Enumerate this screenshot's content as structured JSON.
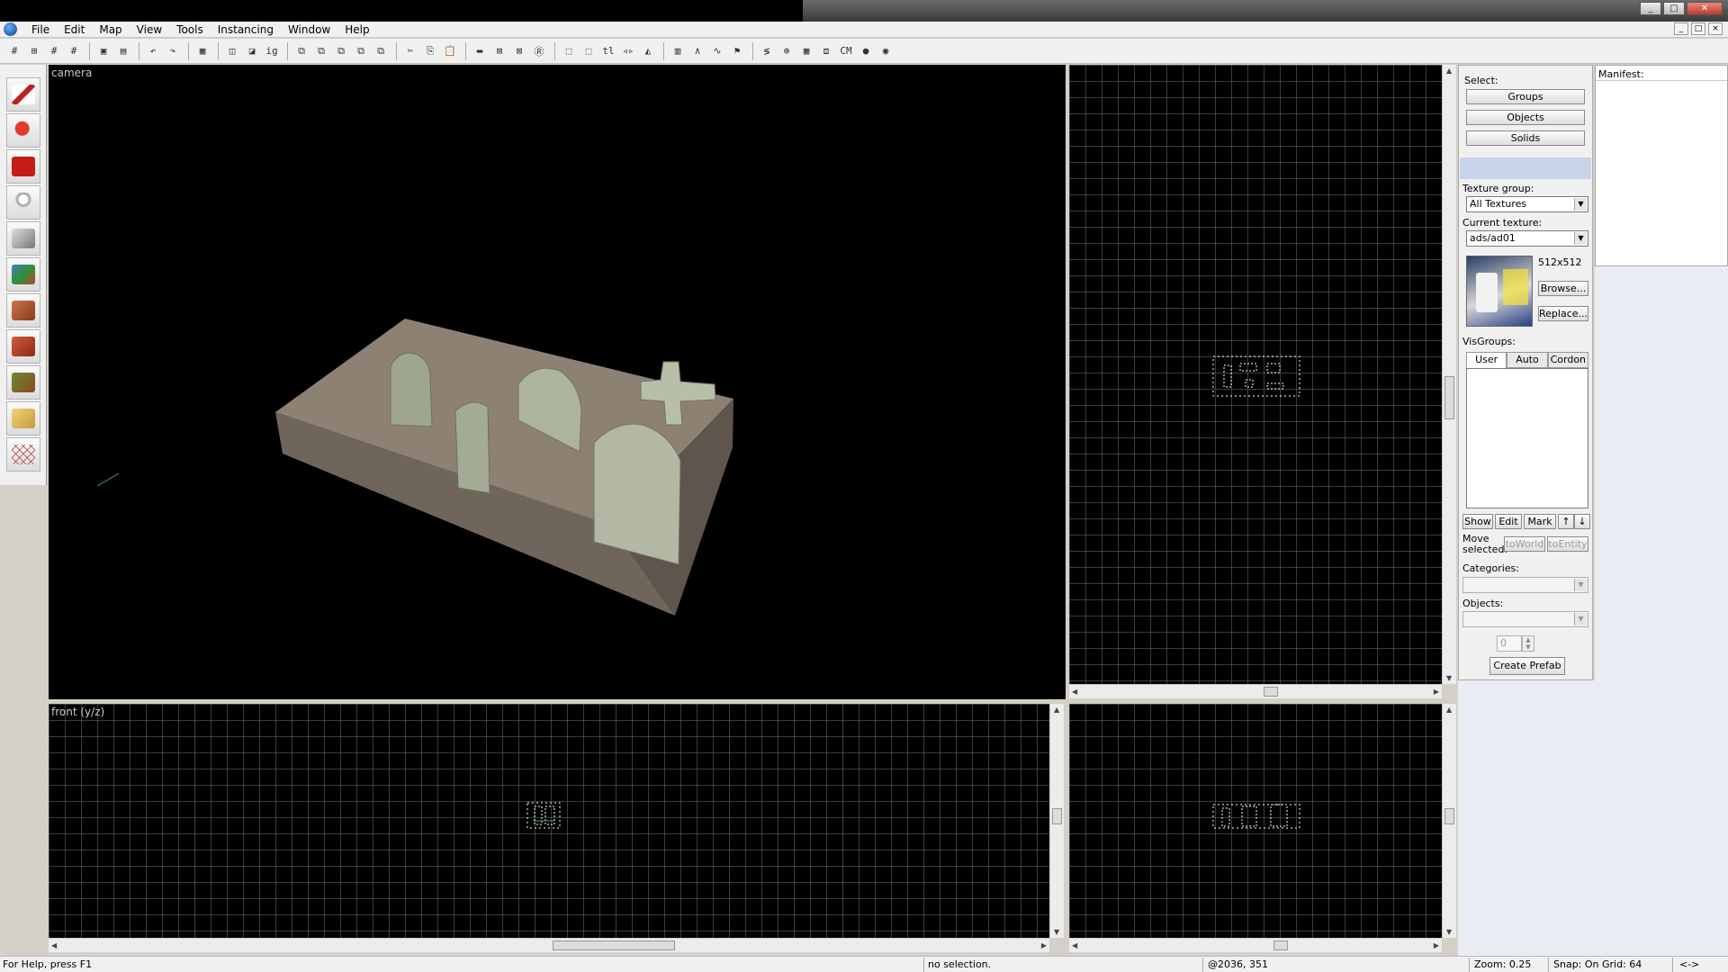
{
  "window": {
    "minimize": "_",
    "maximize": "□",
    "close": "✕"
  },
  "menu": [
    "File",
    "Edit",
    "Map",
    "View",
    "Tools",
    "Instancing",
    "Window",
    "Help"
  ],
  "mdi": [
    "_",
    "□",
    "×"
  ],
  "toolbar_icons": [
    "grid-toggle-icon",
    "grid-3d-icon",
    "grid-small-icon",
    "grid-large-icon",
    "group-icon",
    "ungroup-icon",
    "undo-icon",
    "redo-icon",
    "compile-icon",
    "carve-icon",
    "hollow-icon",
    "clip-icon",
    "vertex-icon",
    "cut-icon",
    "copy-icon",
    "paste-icon",
    "texture-lock-icon",
    "hide-icon",
    "show-icon",
    "cordon-icon",
    "select-icon",
    "autoselect-icon",
    "tl-icon",
    "flip-icon",
    "models-icon",
    "helpers-icon",
    "entity-icon",
    "brush-icon",
    "cm-icon",
    "draw-icon"
  ],
  "tools": [
    "selection-tool",
    "magnify-tool",
    "camera-tool",
    "entity-tool",
    "block-tool",
    "texture-application-tool",
    "apply-texture-tool",
    "decal-tool",
    "overlay-tool",
    "clipping-tool",
    "vertex-tool"
  ],
  "viewports": {
    "camera_label": "camera",
    "front_label": "front (y/z)"
  },
  "right_panel": {
    "select_label": "Select:",
    "groups": "Groups",
    "objects": "Objects",
    "solids": "Solids",
    "texture_group_label": "Texture group:",
    "texture_group_value": "All Textures",
    "current_texture_label": "Current texture:",
    "current_texture_value": "ads/ad01",
    "texture_size": "512x512",
    "browse": "Browse...",
    "replace": "Replace...",
    "visgroups_label": "VisGroups:",
    "tabs": [
      "User",
      "Auto",
      "Cordon"
    ],
    "show": "Show",
    "edit": "Edit",
    "mark": "Mark",
    "up": "↑",
    "down": "↓",
    "move_selected": "Move selected:",
    "to_world": "toWorld",
    "to_entity": "toEntity",
    "categories_label": "Categories:",
    "objects_label": "Objects:",
    "count_value": "0",
    "create_prefab": "Create Prefab"
  },
  "manifest_label": "Manifest:",
  "status": {
    "help": "For Help, press F1",
    "selection": "no selection.",
    "coords": "@2036, 351",
    "zoom": "Zoom: 0.25",
    "snap": "Snap: On Grid: 64",
    "arrows": "<->"
  },
  "colors": {
    "viewport_bg": "#000000",
    "grid_line": "#6e6e6e",
    "selection": "#ffffff",
    "panel_bg": "#f0f0f0"
  }
}
